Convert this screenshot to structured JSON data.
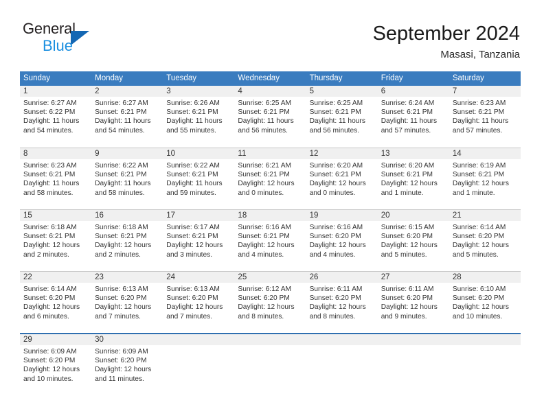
{
  "brand": {
    "name_top": "General",
    "name_bottom": "Blue",
    "triangle_color": "#1467b3",
    "blue_text_color": "#1b8fe0"
  },
  "header": {
    "title": "September 2024",
    "subtitle": "Masasi, Tanzania"
  },
  "theme": {
    "header_blue": "#3a7cbf",
    "daynum_band": "#f0f0f0",
    "grid_line": "#c8c8c8",
    "last_row_rule": "#2f6fb0"
  },
  "calendar": {
    "weekday_headers": [
      "Sunday",
      "Monday",
      "Tuesday",
      "Wednesday",
      "Thursday",
      "Friday",
      "Saturday"
    ],
    "weeks": [
      [
        {
          "day": "1",
          "sunrise": "Sunrise: 6:27 AM",
          "sunset": "Sunset: 6:22 PM",
          "daylight_1": "Daylight: 11 hours",
          "daylight_2": "and 54 minutes."
        },
        {
          "day": "2",
          "sunrise": "Sunrise: 6:27 AM",
          "sunset": "Sunset: 6:21 PM",
          "daylight_1": "Daylight: 11 hours",
          "daylight_2": "and 54 minutes."
        },
        {
          "day": "3",
          "sunrise": "Sunrise: 6:26 AM",
          "sunset": "Sunset: 6:21 PM",
          "daylight_1": "Daylight: 11 hours",
          "daylight_2": "and 55 minutes."
        },
        {
          "day": "4",
          "sunrise": "Sunrise: 6:25 AM",
          "sunset": "Sunset: 6:21 PM",
          "daylight_1": "Daylight: 11 hours",
          "daylight_2": "and 56 minutes."
        },
        {
          "day": "5",
          "sunrise": "Sunrise: 6:25 AM",
          "sunset": "Sunset: 6:21 PM",
          "daylight_1": "Daylight: 11 hours",
          "daylight_2": "and 56 minutes."
        },
        {
          "day": "6",
          "sunrise": "Sunrise: 6:24 AM",
          "sunset": "Sunset: 6:21 PM",
          "daylight_1": "Daylight: 11 hours",
          "daylight_2": "and 57 minutes."
        },
        {
          "day": "7",
          "sunrise": "Sunrise: 6:23 AM",
          "sunset": "Sunset: 6:21 PM",
          "daylight_1": "Daylight: 11 hours",
          "daylight_2": "and 57 minutes."
        }
      ],
      [
        {
          "day": "8",
          "sunrise": "Sunrise: 6:23 AM",
          "sunset": "Sunset: 6:21 PM",
          "daylight_1": "Daylight: 11 hours",
          "daylight_2": "and 58 minutes."
        },
        {
          "day": "9",
          "sunrise": "Sunrise: 6:22 AM",
          "sunset": "Sunset: 6:21 PM",
          "daylight_1": "Daylight: 11 hours",
          "daylight_2": "and 58 minutes."
        },
        {
          "day": "10",
          "sunrise": "Sunrise: 6:22 AM",
          "sunset": "Sunset: 6:21 PM",
          "daylight_1": "Daylight: 11 hours",
          "daylight_2": "and 59 minutes."
        },
        {
          "day": "11",
          "sunrise": "Sunrise: 6:21 AM",
          "sunset": "Sunset: 6:21 PM",
          "daylight_1": "Daylight: 12 hours",
          "daylight_2": "and 0 minutes."
        },
        {
          "day": "12",
          "sunrise": "Sunrise: 6:20 AM",
          "sunset": "Sunset: 6:21 PM",
          "daylight_1": "Daylight: 12 hours",
          "daylight_2": "and 0 minutes."
        },
        {
          "day": "13",
          "sunrise": "Sunrise: 6:20 AM",
          "sunset": "Sunset: 6:21 PM",
          "daylight_1": "Daylight: 12 hours",
          "daylight_2": "and 1 minute."
        },
        {
          "day": "14",
          "sunrise": "Sunrise: 6:19 AM",
          "sunset": "Sunset: 6:21 PM",
          "daylight_1": "Daylight: 12 hours",
          "daylight_2": "and 1 minute."
        }
      ],
      [
        {
          "day": "15",
          "sunrise": "Sunrise: 6:18 AM",
          "sunset": "Sunset: 6:21 PM",
          "daylight_1": "Daylight: 12 hours",
          "daylight_2": "and 2 minutes."
        },
        {
          "day": "16",
          "sunrise": "Sunrise: 6:18 AM",
          "sunset": "Sunset: 6:21 PM",
          "daylight_1": "Daylight: 12 hours",
          "daylight_2": "and 2 minutes."
        },
        {
          "day": "17",
          "sunrise": "Sunrise: 6:17 AM",
          "sunset": "Sunset: 6:21 PM",
          "daylight_1": "Daylight: 12 hours",
          "daylight_2": "and 3 minutes."
        },
        {
          "day": "18",
          "sunrise": "Sunrise: 6:16 AM",
          "sunset": "Sunset: 6:21 PM",
          "daylight_1": "Daylight: 12 hours",
          "daylight_2": "and 4 minutes."
        },
        {
          "day": "19",
          "sunrise": "Sunrise: 6:16 AM",
          "sunset": "Sunset: 6:20 PM",
          "daylight_1": "Daylight: 12 hours",
          "daylight_2": "and 4 minutes."
        },
        {
          "day": "20",
          "sunrise": "Sunrise: 6:15 AM",
          "sunset": "Sunset: 6:20 PM",
          "daylight_1": "Daylight: 12 hours",
          "daylight_2": "and 5 minutes."
        },
        {
          "day": "21",
          "sunrise": "Sunrise: 6:14 AM",
          "sunset": "Sunset: 6:20 PM",
          "daylight_1": "Daylight: 12 hours",
          "daylight_2": "and 5 minutes."
        }
      ],
      [
        {
          "day": "22",
          "sunrise": "Sunrise: 6:14 AM",
          "sunset": "Sunset: 6:20 PM",
          "daylight_1": "Daylight: 12 hours",
          "daylight_2": "and 6 minutes."
        },
        {
          "day": "23",
          "sunrise": "Sunrise: 6:13 AM",
          "sunset": "Sunset: 6:20 PM",
          "daylight_1": "Daylight: 12 hours",
          "daylight_2": "and 7 minutes."
        },
        {
          "day": "24",
          "sunrise": "Sunrise: 6:13 AM",
          "sunset": "Sunset: 6:20 PM",
          "daylight_1": "Daylight: 12 hours",
          "daylight_2": "and 7 minutes."
        },
        {
          "day": "25",
          "sunrise": "Sunrise: 6:12 AM",
          "sunset": "Sunset: 6:20 PM",
          "daylight_1": "Daylight: 12 hours",
          "daylight_2": "and 8 minutes."
        },
        {
          "day": "26",
          "sunrise": "Sunrise: 6:11 AM",
          "sunset": "Sunset: 6:20 PM",
          "daylight_1": "Daylight: 12 hours",
          "daylight_2": "and 8 minutes."
        },
        {
          "day": "27",
          "sunrise": "Sunrise: 6:11 AM",
          "sunset": "Sunset: 6:20 PM",
          "daylight_1": "Daylight: 12 hours",
          "daylight_2": "and 9 minutes."
        },
        {
          "day": "28",
          "sunrise": "Sunrise: 6:10 AM",
          "sunset": "Sunset: 6:20 PM",
          "daylight_1": "Daylight: 12 hours",
          "daylight_2": "and 10 minutes."
        }
      ],
      [
        {
          "day": "29",
          "sunrise": "Sunrise: 6:09 AM",
          "sunset": "Sunset: 6:20 PM",
          "daylight_1": "Daylight: 12 hours",
          "daylight_2": "and 10 minutes."
        },
        {
          "day": "30",
          "sunrise": "Sunrise: 6:09 AM",
          "sunset": "Sunset: 6:20 PM",
          "daylight_1": "Daylight: 12 hours",
          "daylight_2": "and 11 minutes."
        },
        {
          "day": "",
          "sunrise": "",
          "sunset": "",
          "daylight_1": "",
          "daylight_2": ""
        },
        {
          "day": "",
          "sunrise": "",
          "sunset": "",
          "daylight_1": "",
          "daylight_2": ""
        },
        {
          "day": "",
          "sunrise": "",
          "sunset": "",
          "daylight_1": "",
          "daylight_2": ""
        },
        {
          "day": "",
          "sunrise": "",
          "sunset": "",
          "daylight_1": "",
          "daylight_2": ""
        },
        {
          "day": "",
          "sunrise": "",
          "sunset": "",
          "daylight_1": "",
          "daylight_2": ""
        }
      ]
    ]
  }
}
